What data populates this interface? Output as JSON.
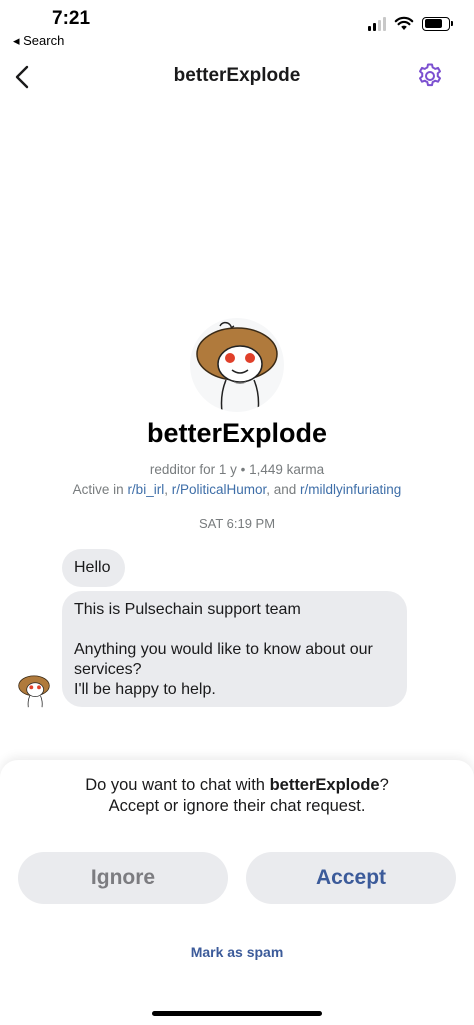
{
  "status_bar": {
    "time": "7:21",
    "back_label": "◂ Search",
    "battery_level": 0.75,
    "signal_bars": 2
  },
  "nav": {
    "title": "betterExplode",
    "back_icon": "chevron-left-icon",
    "settings_icon": "gear-icon"
  },
  "profile": {
    "name": "betterExplode",
    "meta": "redditor for 1 y • 1,449 karma",
    "active_prefix": "Active in ",
    "communities": [
      "r/bi_irl",
      "r/PoliticalHumor",
      "r/mildlyinfuriating"
    ],
    "sep_1": ", ",
    "sep_2": ", and "
  },
  "chat": {
    "timestamp": "SAT 6:19 PM",
    "messages": [
      {
        "text": "Hello"
      },
      {
        "lines": [
          "This is Pulsechain support team",
          "",
          "Anything you would like to know about our",
          "services?",
          "I'll be happy to help."
        ]
      }
    ]
  },
  "request": {
    "prompt_pre": "Do you want to chat with ",
    "prompt_user": "betterExplode",
    "prompt_post": "?",
    "prompt_line2": "Accept or ignore their chat request.",
    "ignore_label": "Ignore",
    "accept_label": "Accept",
    "spam_label": "Mark as spam"
  },
  "colors": {
    "accent": "#3c5b9a",
    "link": "#3e6ea8",
    "gear": "#7b4fd0",
    "bubble": "#eaebee",
    "muted": "#787c7e"
  }
}
